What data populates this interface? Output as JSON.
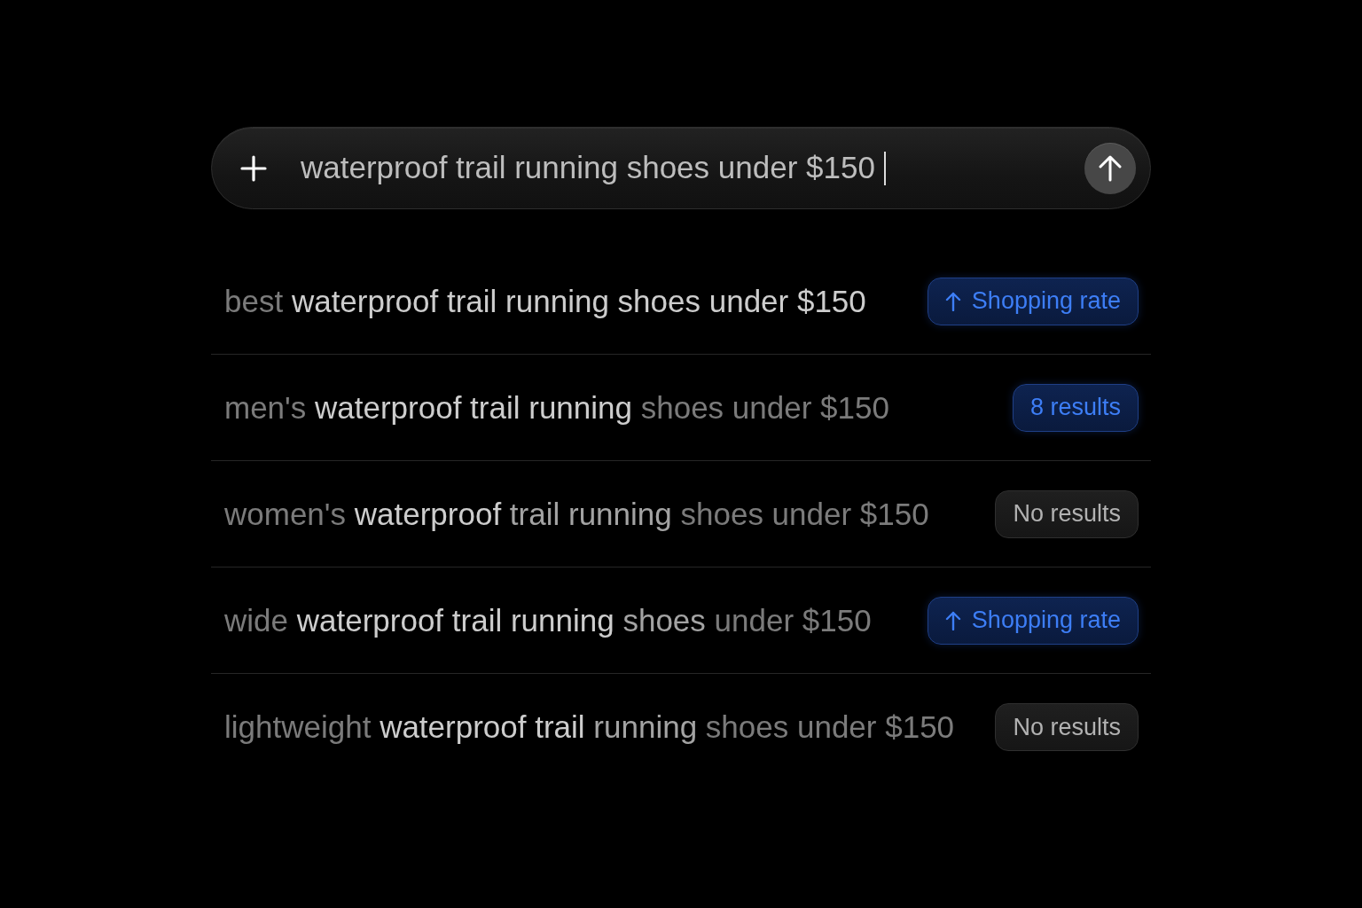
{
  "search_bar": {
    "value": "waterproof trail running shoes under $150",
    "focused": true
  },
  "suggestions": [
    {
      "segments": [
        {
          "text": "best",
          "kind": "dim"
        },
        {
          "text": "waterproof trail running shoes under $150",
          "kind": "bright"
        }
      ],
      "badge": {
        "label": "Shopping rate",
        "kind": "accent",
        "arrow": true
      }
    },
    {
      "segments": [
        {
          "text": "men's",
          "kind": "dim"
        },
        {
          "text": "waterproof trail running",
          "kind": "bright"
        },
        {
          "text": "shoes under $150",
          "kind": "dim"
        }
      ],
      "badge": {
        "label": "8 results",
        "kind": "accent",
        "arrow": false
      }
    },
    {
      "segments": [
        {
          "text": "women's",
          "kind": "dim"
        },
        {
          "text": "waterproof",
          "kind": "bright"
        },
        {
          "text": "trail running",
          "kind": "mid"
        },
        {
          "text": "shoes under $150",
          "kind": "dim"
        }
      ],
      "badge": {
        "label": "No results",
        "kind": "neutral",
        "arrow": false
      }
    },
    {
      "segments": [
        {
          "text": "wide",
          "kind": "dim"
        },
        {
          "text": "waterproof trail running",
          "kind": "bright"
        },
        {
          "text": "shoes",
          "kind": "mid"
        },
        {
          "text": "under $150",
          "kind": "dim"
        }
      ],
      "badge": {
        "label": "Shopping rate",
        "kind": "accent",
        "arrow": true
      }
    },
    {
      "segments": [
        {
          "text": "lightweight",
          "kind": "dim"
        },
        {
          "text": "waterproof trail",
          "kind": "bright"
        },
        {
          "text": "running",
          "kind": "mid"
        },
        {
          "text": "shoes under $150",
          "kind": "dim"
        }
      ],
      "badge": {
        "label": "No results",
        "kind": "neutral",
        "arrow": false
      }
    }
  ]
}
